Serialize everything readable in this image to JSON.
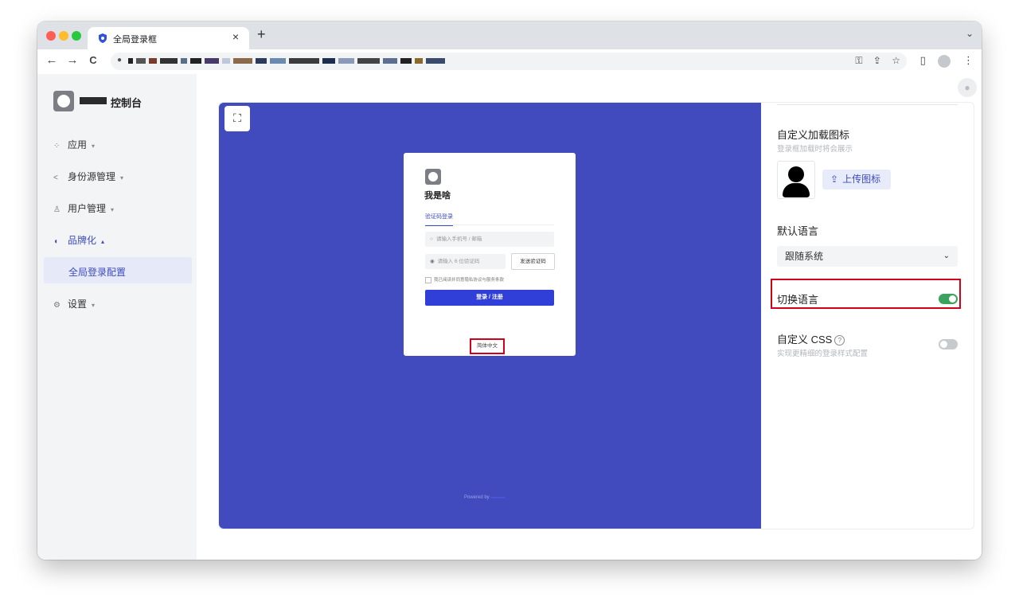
{
  "browser": {
    "tab_title": "全局登录框",
    "tab_close": "×",
    "new_tab": "+",
    "tab_menu": "⌄",
    "back": "←",
    "forward": "→",
    "reload": "C",
    "lock_icon": "🔒",
    "key_icon": "⚿",
    "share_icon": "⇪",
    "star_icon": "☆",
    "sidebar_icon": "▯",
    "more_icon": "⋮"
  },
  "sidebar": {
    "brand": "控制台",
    "items": [
      {
        "label": "应用",
        "icon": "grid-icon",
        "glyph": "⁘"
      },
      {
        "label": "身份源管理",
        "icon": "share-icon",
        "glyph": "<"
      },
      {
        "label": "用户管理",
        "icon": "users-icon",
        "glyph": "♙"
      },
      {
        "label": "品牌化",
        "icon": "brand-icon",
        "glyph": "◖"
      },
      {
        "label": "设置",
        "icon": "gear-icon",
        "glyph": "⚙"
      }
    ],
    "sub_item": "全局登录配置",
    "caret_down": "▾",
    "caret_up": "▴"
  },
  "preview": {
    "fullscreen_glyph": "⛶",
    "login": {
      "title": "我是啥",
      "tab": "验证码登录",
      "phone_placeholder": "请输入手机号 / 邮箱",
      "code_placeholder": "请输入 6 位验证码",
      "send_code": "发送验证码",
      "agreement": "我已阅读并同意隐私协议与服务条款",
      "submit": "登录 / 注册",
      "language": "简体中文"
    },
    "powered_by": "Powered by"
  },
  "panel": {
    "loading_icon_title": "自定义加载图标",
    "loading_icon_sub": "登录框加载时将会展示",
    "upload_label": "上传图标",
    "default_language_title": "默认语言",
    "default_language_value": "跟随系统",
    "switch_language_label": "切换语言",
    "switch_language_on": true,
    "custom_css_label": "自定义 CSS",
    "custom_css_sub": "实现更精细的登录样式配置",
    "custom_css_on": false,
    "question_mark": "?"
  },
  "colors": {
    "preview_bg": "#424bbd",
    "primary": "#2f3fd8",
    "accent": "#3e4bbd",
    "toggle_on": "#3aa35d",
    "highlight_red": "#d0021b"
  }
}
